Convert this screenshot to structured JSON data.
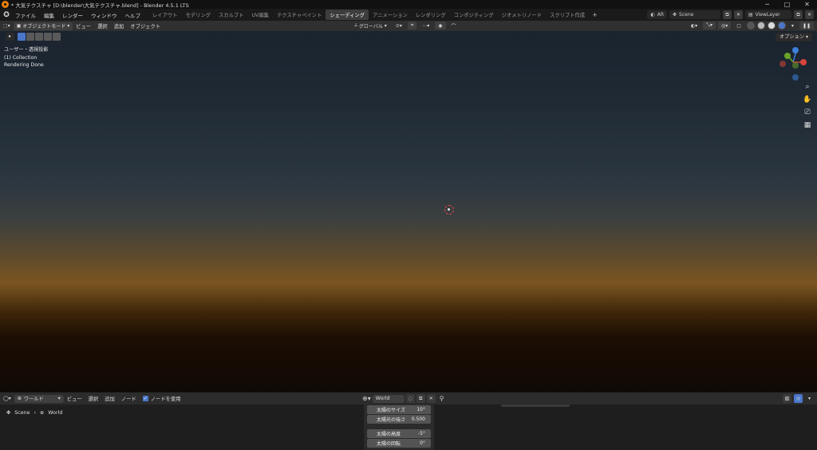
{
  "window": {
    "title": "* 大気テクスチャ [D:\\blender\\大気テクスチャ.blend] - Blender 4.5.1 LTS",
    "controls": [
      "─",
      "□",
      "✕"
    ]
  },
  "menubar": {
    "menus": [
      "ファイル",
      "編集",
      "レンダー",
      "ウィンドウ",
      "ヘルプ"
    ],
    "tabs": [
      "レイアウト",
      "モデリング",
      "スカルプト",
      "UV編集",
      "テクスチャペイント",
      "シェーディング",
      "アニメーション",
      "レンダリング",
      "コンポジティング",
      "ジオメトリノード",
      "スクリプト作成"
    ],
    "active_tab_index": 5,
    "ar_label": "AR",
    "scene": "Scene",
    "view_layer": "ViewLayer"
  },
  "header3d": {
    "mode": "オブジェクトモード",
    "menus": [
      "ビュー",
      "選択",
      "追加",
      "オブジェクト"
    ],
    "transform_orientation": "グローバル"
  },
  "viewport": {
    "overlay_lines": [
      "ユーザー・透視投影",
      "(1) Collection",
      "Rendering Done"
    ],
    "options_label": "オプション",
    "gizmo_colors": {
      "x": "#d6453b",
      "y": "#6ba329",
      "z": "#3d7fd9"
    }
  },
  "nodebar": {
    "editor_type": "ワールド",
    "menus": [
      "ビュー",
      "選択",
      "追加",
      "ノード"
    ],
    "use_nodes_label": "ノードを使用",
    "world_name": "World"
  },
  "breadcrumb": {
    "scene": "Scene",
    "world": "World"
  },
  "sun_panel": {
    "rows": [
      {
        "label": "太陽のサイズ",
        "value": "10°"
      },
      {
        "label": "太陽光の強さ",
        "value": "0.500"
      },
      {
        "label": "太陽の高度",
        "value": "-5°"
      },
      {
        "label": "太陽の回転",
        "value": "0°"
      }
    ]
  }
}
